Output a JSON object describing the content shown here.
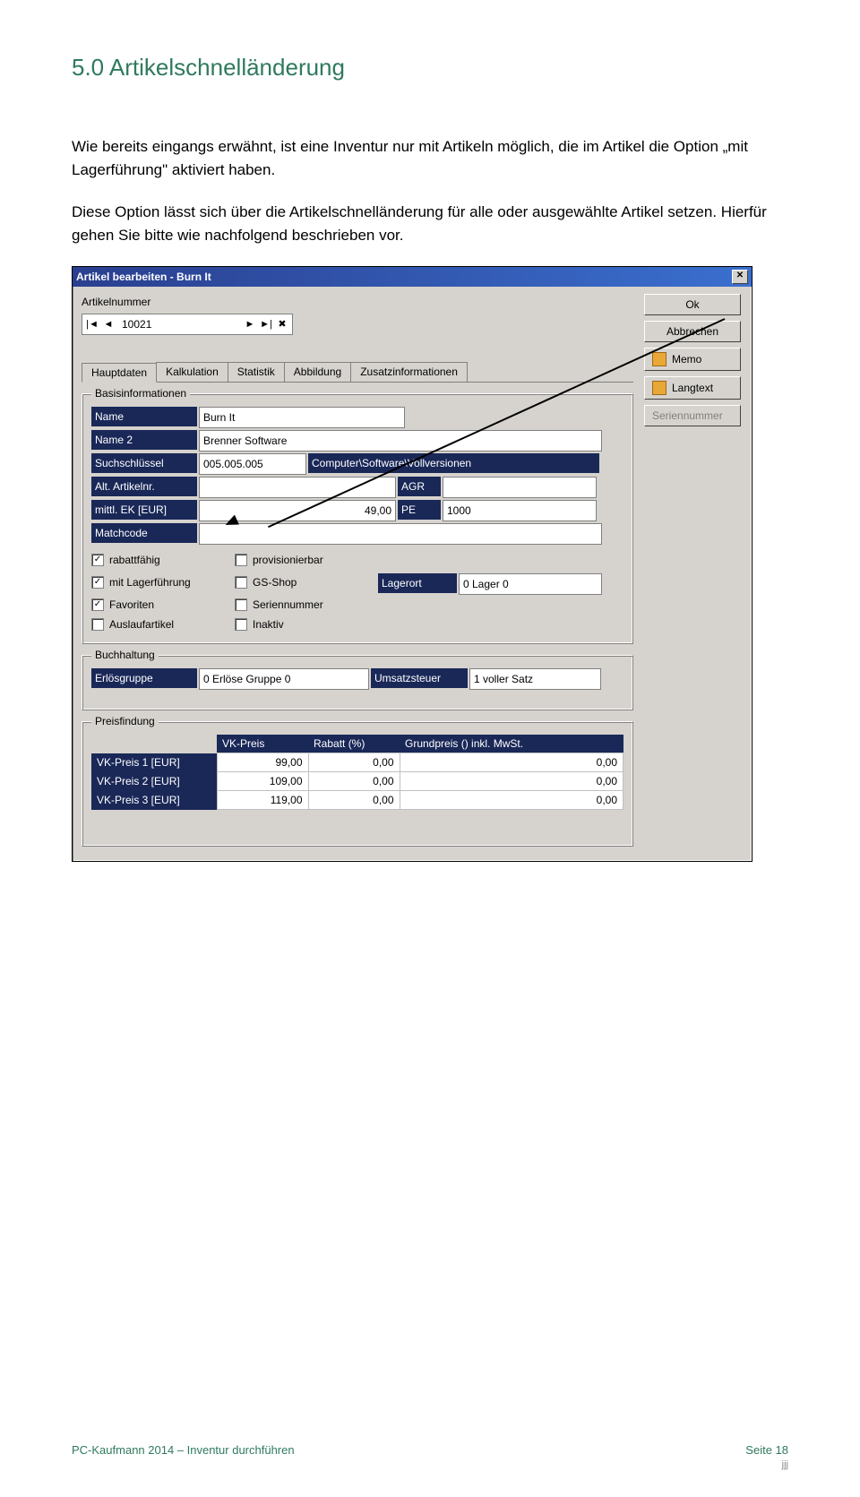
{
  "heading": "5.0  Artikelschnelländerung",
  "para1": "Wie bereits eingangs erwähnt, ist eine Inventur nur mit Artikeln möglich, die im Artikel die Option „mit Lagerführung\" aktiviert haben.",
  "para2": "Diese Option lässt sich über die Artikelschnelländerung für alle oder ausgewählte Artikel setzen. Hierfür gehen Sie bitte wie nachfolgend beschrieben vor.",
  "window": {
    "title": "Artikel bearbeiten - Burn It",
    "articleNumberLabel": "Artikelnummer",
    "articleNumber": "10021",
    "buttons": {
      "ok": "Ok",
      "cancel": "Abbrechen",
      "memo": "Memo",
      "langtext": "Langtext",
      "serien": "Seriennummer"
    },
    "tabs": [
      "Hauptdaten",
      "Kalkulation",
      "Statistik",
      "Abbildung",
      "Zusatzinformationen"
    ],
    "basis": {
      "legend": "Basisinformationen",
      "fields": {
        "name_label": "Name",
        "name_val": "Burn It",
        "name2_label": "Name 2",
        "name2_val": "Brenner Software",
        "such_label": "Suchschlüssel",
        "such_val": "005.005.005",
        "such_path": "Computer\\Software\\Vollversionen",
        "alt_label": "Alt. Artikelnr.",
        "agr_label": "AGR",
        "ek_label": "mittl. EK [EUR]",
        "ek_val": "49,00",
        "pe_label": "PE",
        "pe_val": "1000",
        "match_label": "Matchcode"
      },
      "checks": {
        "rabatt": "rabattfähig",
        "prov": "provisionierbar",
        "lager": "mit Lagerführung",
        "gs": "GS-Shop",
        "lagerort_label": "Lagerort",
        "lagerort_val": "0 Lager 0",
        "fav": "Favoriten",
        "serien": "Seriennummer",
        "auslauf": "Auslaufartikel",
        "inaktiv": "Inaktiv"
      }
    },
    "buch": {
      "legend": "Buchhaltung",
      "erlos_label": "Erlösgruppe",
      "erlos_val": "0 Erlöse Gruppe 0",
      "ust_label": "Umsatzsteuer",
      "ust_val": "1 voller Satz"
    },
    "preis": {
      "legend": "Preisfindung",
      "headers": [
        "",
        "VK-Preis",
        "Rabatt (%)",
        "Grundpreis () inkl. MwSt."
      ],
      "rows": [
        {
          "label": "VK-Preis 1 [EUR]",
          "vk": "99,00",
          "rab": "0,00",
          "gp": "0,00"
        },
        {
          "label": "VK-Preis 2 [EUR]",
          "vk": "109,00",
          "rab": "0,00",
          "gp": "0,00"
        },
        {
          "label": "VK-Preis 3 [EUR]",
          "vk": "119,00",
          "rab": "0,00",
          "gp": "0,00"
        }
      ]
    }
  },
  "footer": {
    "left": "PC-Kaufmann 2014 – Inventur durchführen",
    "page": "Seite 18",
    "sub": "jjj"
  }
}
